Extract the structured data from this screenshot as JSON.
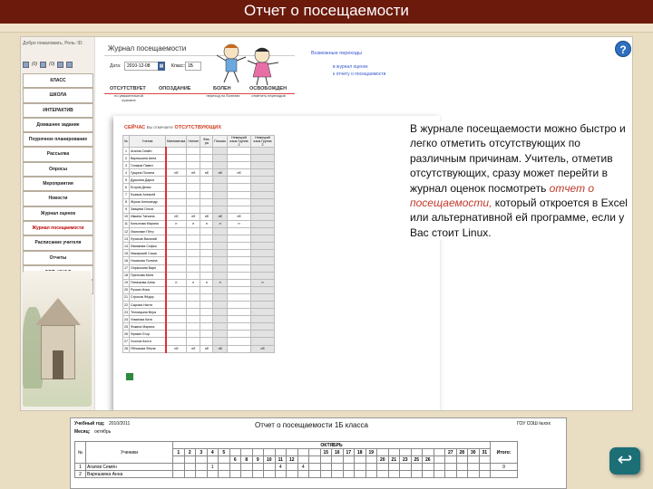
{
  "slide_title": "Отчет о посещаемости",
  "sidebar": {
    "welcome": "Добро пожаловать, Роль: ID:",
    "icon_counts": [
      "(0)",
      "(0)"
    ],
    "menu": [
      "КЛАСС",
      "ШКОЛА",
      "ИНТЕРАКТИВ",
      "Домашнее задание",
      "Поурочное планирование",
      "Рассылка",
      "Опросы",
      "Мероприятия",
      "Новости",
      "Журнал оценок",
      "Журнал посещаемости",
      "Расписание учителя",
      "Отчеты",
      "ДОП. ИНФО",
      "Выход"
    ],
    "active_index": 10
  },
  "journal": {
    "title": "Журнал посещаемости",
    "date_label": "Дата:",
    "date_value": "2010-12-08",
    "class_label": "Класс:",
    "class_value": "1Б",
    "possible_title": "Возможные переходы",
    "links": [
      "в журнал оценок",
      "к отчету о посещаемости"
    ],
    "statuses": [
      {
        "label": "ОТСУТСТВУЕТ",
        "sub": "по уважительной причине"
      },
      {
        "label": "ОПОЗДАНИЕ",
        "sub": ""
      },
      {
        "label": "БОЛЕН",
        "sub": "переход по болезни"
      },
      {
        "label": "ОСВОБОЖДЕН",
        "sub": "отметить переходов"
      }
    ],
    "now_title": "СЕЙЧАС",
    "now_sub": "Вы отмечаете",
    "now_status": "ОТСУТСТВУЮЩИХ",
    "columns": [
      "№",
      "Ученик",
      "Математика",
      "Чтение",
      "Физ-ра",
      "Письмо",
      "Немецкий язык Группа 1",
      "Немецкий язык Группа 2"
    ],
    "students": [
      [
        "1",
        "Агапов Семён",
        "",
        "",
        "",
        "",
        "",
        ""
      ],
      [
        "2",
        "Варешкина Анна",
        "",
        "",
        "",
        "",
        "",
        ""
      ],
      [
        "3",
        "Гоняков Павел",
        "",
        "",
        "",
        "",
        "",
        ""
      ],
      [
        "4",
        "Гущина Полина",
        "нб",
        "нб",
        "нб",
        "нб",
        "нб",
        ""
      ],
      [
        "5",
        "Душкина Дарья",
        "",
        "",
        "",
        "",
        "",
        ""
      ],
      [
        "6",
        "Егоров Денис",
        "",
        "",
        "",
        "",
        "",
        ""
      ],
      [
        "7",
        "Ежиков Алексей",
        "",
        "",
        "",
        "",
        "",
        ""
      ],
      [
        "8",
        "Жуков Александр",
        "",
        "",
        "",
        "",
        "",
        ""
      ],
      [
        "9",
        "Заяцева Ольга",
        "",
        "",
        "",
        "",
        "",
        ""
      ],
      [
        "10",
        "Ивкина Татьяна",
        "нб",
        "нб",
        "нб",
        "нб",
        "нб",
        ""
      ],
      [
        "11",
        "Копылова Марина",
        "н",
        "н",
        "н",
        "н",
        "н",
        ""
      ],
      [
        "12",
        "Лимонкин Пётр",
        "",
        "",
        "",
        "",
        "",
        ""
      ],
      [
        "13",
        "Лучиков Василий",
        "",
        "",
        "",
        "",
        "",
        ""
      ],
      [
        "14",
        "Лямякова Софья",
        "",
        "",
        "",
        "",
        "",
        ""
      ],
      [
        "15",
        "Макарский Саша",
        "",
        "",
        "",
        "",
        "",
        ""
      ],
      [
        "16",
        "Носикова Полина",
        "",
        "",
        "",
        "",
        "",
        ""
      ],
      [
        "17",
        "Опрыскина Варя",
        "",
        "",
        "",
        "",
        "",
        ""
      ],
      [
        "18",
        "Пряткова Митя",
        "",
        "",
        "",
        "",
        "",
        ""
      ],
      [
        "19",
        "Пятачкова Анна",
        "н",
        "н",
        "н",
        "н",
        "",
        "н"
      ],
      [
        "20",
        "Ручкин Илья",
        "",
        "",
        "",
        "",
        "",
        ""
      ],
      [
        "21",
        "Строков Фёдор",
        "",
        "",
        "",
        "",
        "",
        ""
      ],
      [
        "22",
        "Сырова Настя",
        "",
        "",
        "",
        "",
        "",
        ""
      ],
      [
        "23",
        "Теплицына Вера",
        "",
        "",
        "",
        "",
        "",
        ""
      ],
      [
        "24",
        "Ухватова Катя",
        "",
        "",
        "",
        "",
        "",
        ""
      ],
      [
        "25",
        "Фокина Марина",
        "",
        "",
        "",
        "",
        "",
        ""
      ],
      [
        "26",
        "Фрязин Егор",
        "",
        "",
        "",
        "",
        "",
        ""
      ],
      [
        "27",
        "Хохлов Костя",
        "",
        "",
        "",
        "",
        "",
        ""
      ],
      [
        "28",
        "Яблокова Фёкла",
        "нб",
        "нб",
        "нб",
        "нб",
        "",
        "нб"
      ]
    ]
  },
  "description": {
    "text1": "В журнале посещаемости можно быстро и легко отметить отсутствующих по различным причинам. Учитель, отметив отсутствующих, сразу может перейти в журнал оценок посмотреть ",
    "emph": "отчет о посещаемости,",
    "text2": " который откроется в Excel или альтернативной ей программе, если у Вас стоит Linux."
  },
  "report": {
    "year_label": "Учебный год:",
    "year_value": "2010/2011",
    "month_label": "Месяц:",
    "month_value": "октябрь",
    "title": "Отчет о посещаемости 1Б класса",
    "school": "ГОУ СОШ №ххх",
    "month_header": "ОКТЯБРЬ",
    "col_no": "№",
    "col_no2": "п/п",
    "col_students": "Ученики",
    "col_total": "Итого:",
    "days_top": [
      "1",
      "2",
      "3",
      "4",
      "5",
      "",
      "",
      "",
      "",
      "",
      "",
      "",
      "",
      "15",
      "16",
      "17",
      "18",
      "19",
      "",
      "",
      "",
      "",
      "",
      "",
      "27",
      "28",
      "30",
      "31"
    ],
    "days_bottom": [
      "",
      "",
      "",
      "",
      "",
      "6",
      "8",
      "9",
      "10",
      "11",
      "12",
      "",
      "",
      "",
      "",
      "",
      "",
      "",
      "20",
      "21",
      "23",
      "25",
      "26",
      "",
      "",
      "",
      "",
      ""
    ],
    "rows": [
      {
        "n": "1",
        "name": "Агапов Семён",
        "marks": {
          "3": "1",
          "9": "4",
          "11": "4"
        },
        "total": "9"
      },
      {
        "n": "2",
        "name": "Варешкина Анна",
        "marks": {},
        "total": ""
      }
    ]
  }
}
